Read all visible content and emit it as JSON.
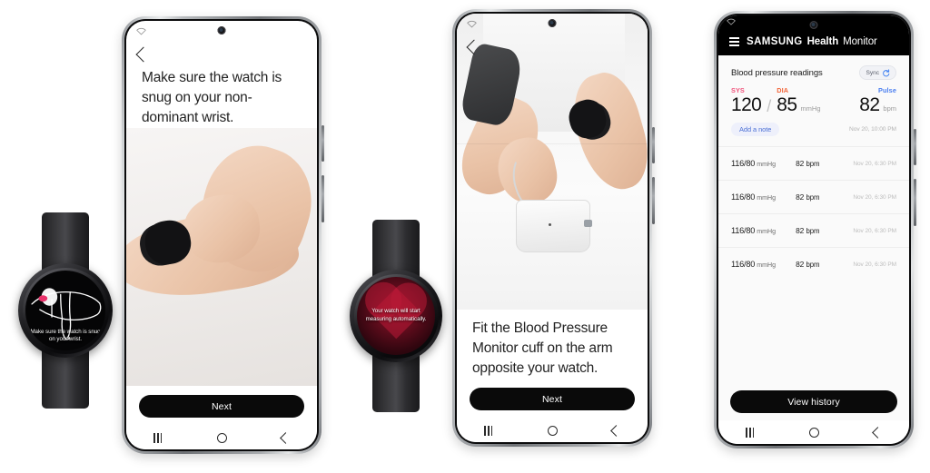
{
  "background_color": "#ffffff",
  "accents": {
    "sys": "#f0547c",
    "dia": "#f2663a",
    "pulse": "#4a7ef0",
    "link": "#4a6fd4",
    "button_bg": "#0a0a0a"
  },
  "panels": [
    {
      "id": "panel-wear-watch",
      "watch": {
        "face_style": "dark-line-art",
        "text": "Make sure the watch is snug on your wrist.",
        "art_name": "hand-adjusting-watch-line-art"
      },
      "phone": {
        "statusbar_icon": "wifi-icon",
        "back_icon": "back-chevron-icon",
        "title": "Make sure the watch is snug on your non-dominant wrist.",
        "photo_alt": "hands fastening a smartwatch on the left wrist on a white table",
        "primary_button": "Next",
        "navbar": [
          "recents-icon",
          "home-icon",
          "back-icon"
        ]
      }
    },
    {
      "id": "panel-fit-cuff",
      "watch": {
        "face_style": "red-heart",
        "text": "Your watch will start measuring automatically.",
        "art_name": "heart-icon"
      },
      "phone": {
        "statusbar_icon": "wifi-icon",
        "back_icon": "back-chevron-icon",
        "title": "Fit the Blood Pressure Monitor cuff on the arm opposite your watch.",
        "photo_alt": "person wearing a blood pressure cuff on the upper arm with the monitor on a white table",
        "primary_button": "Next",
        "navbar": [
          "recents-icon",
          "home-icon",
          "back-icon"
        ]
      }
    }
  ],
  "app": {
    "statusbar_icon": "wifi-icon",
    "menu_icon": "hamburger-menu-icon",
    "brand": {
      "samsung": "SAMSUNG",
      "health": "Health",
      "monitor": "Monitor"
    },
    "section_title": "Blood pressure readings",
    "sync": {
      "label": "Sync",
      "icon": "refresh-icon"
    },
    "latest": {
      "sys_label": "SYS",
      "dia_label": "DIA",
      "pulse_label": "Pulse",
      "sys_value": "120",
      "separator": "/",
      "dia_value": "85",
      "bp_unit": "mmHg",
      "pulse_value": "82",
      "pulse_unit": "bpm",
      "note_button": "Add a note",
      "timestamp": "Nov 20, 10:00 PM"
    },
    "readings": [
      {
        "bp": "116/80",
        "bp_unit": "mmHg",
        "pulse": "82",
        "pulse_unit": "bpm",
        "time": "Nov 20, 6:30 PM"
      },
      {
        "bp": "116/80",
        "bp_unit": "mmHg",
        "pulse": "82",
        "pulse_unit": "bpm",
        "time": "Nov 20, 6:30 PM"
      },
      {
        "bp": "116/80",
        "bp_unit": "mmHg",
        "pulse": "82",
        "pulse_unit": "bpm",
        "time": "Nov 20, 6:30 PM"
      },
      {
        "bp": "116/80",
        "bp_unit": "mmHg",
        "pulse": "82",
        "pulse_unit": "bpm",
        "time": "Nov 20, 6:30 PM"
      }
    ],
    "history_button": "View history",
    "navbar": [
      "recents-icon",
      "home-icon",
      "back-icon"
    ]
  }
}
